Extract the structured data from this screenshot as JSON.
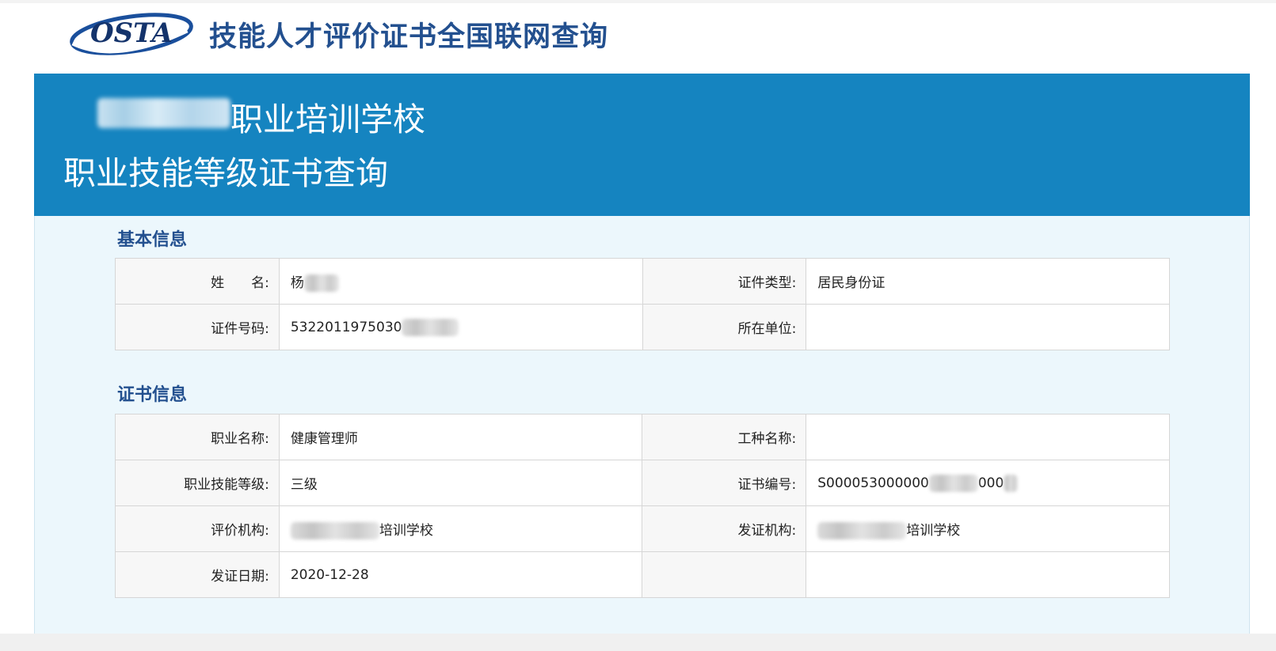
{
  "header": {
    "logo_text": "OSTA",
    "site_title": "技能人才评价证书全国联网查询"
  },
  "banner": {
    "school_suffix": "职业培训学校",
    "subtitle": "职业技能等级证书查询"
  },
  "basic_info": {
    "title": "基本信息",
    "name_label": "姓　　名:",
    "name_value": "杨",
    "id_type_label": "证件类型:",
    "id_type_value": "居民身份证",
    "id_number_label": "证件号码:",
    "id_number_value": "5322011975030",
    "employer_label": "所在单位:",
    "employer_value": ""
  },
  "cert_info": {
    "title": "证书信息",
    "occupation_label": "职业名称:",
    "occupation_value": "健康管理师",
    "job_type_label": "工种名称:",
    "job_type_value": "",
    "level_label": "职业技能等级:",
    "level_value": "三级",
    "cert_no_label": "证书编号:",
    "cert_no_prefix": "S000053000000",
    "cert_no_suffix": "000",
    "evaluator_label": "评价机构:",
    "evaluator_suffix": "培训学校",
    "issuer_label": "发证机构:",
    "issuer_suffix": "培训学校",
    "issue_date_label": "发证日期:",
    "issue_date_value": "2020-12-28"
  },
  "colors": {
    "banner": "#1584c0",
    "title_blue": "#23508f",
    "content_bg": "#ecf7fc"
  }
}
